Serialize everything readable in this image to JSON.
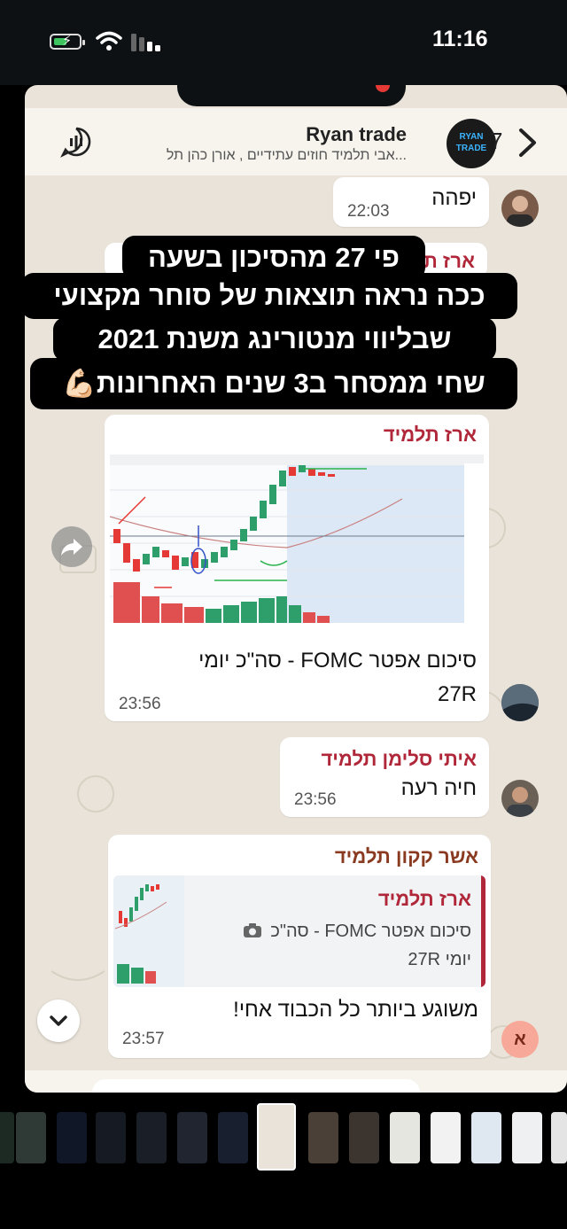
{
  "status_bar": {
    "time": "11:16"
  },
  "chat": {
    "title": "Ryan trade",
    "subtitle": "אבי תלמיד חוזים עתידיים , אורן כהן תל...",
    "back_count": "7",
    "avatar_text": "RYAN TRADE"
  },
  "messages": [
    {
      "text": "יפהה",
      "time": "22:03"
    },
    {
      "sender": "ארז תלמיד",
      "caption_line1": "סיכום אפטר FOMC - סה\"כ יומי",
      "caption_line2": "27R",
      "time": "23:56"
    },
    {
      "sender": "איתי סלימן תלמיד",
      "text": "חיה רעה",
      "time": "23:56"
    },
    {
      "sender": "אשר קקון תלמיד",
      "quoted_sender": "ארז תלמיד",
      "quoted_line1": "סיכום אפטר FOMC - סה\"כ",
      "quoted_line2": "יומי 27R",
      "text": "משוגע ביותר כל הכבוד אחי!",
      "time": "23:57"
    }
  ],
  "overlay_caption": {
    "line1": "פי 27 מהסיכון בשעה",
    "line2": "ככה נראה תוצאות של סוחר מקצועי",
    "line3": "שבליווי מנטורינג משנת 2021",
    "line4": "שחי ממסחר ב3 שנים האחרונות💪🏻"
  },
  "hidden_sender_fragment": "ארז ת",
  "unread_badge": "א",
  "icons": [
    "battery-charging-icon",
    "wifi-icon",
    "cellular-signal-icon",
    "call-icon",
    "back-chevron-icon",
    "forward-icon",
    "scroll-down-icon",
    "camera-icon"
  ],
  "colors": {
    "sender_red": "#b0273a",
    "sender_brown": "#8a3a20",
    "chat_bg": "#e9e3d9",
    "badge_bg": "#f7a898"
  }
}
